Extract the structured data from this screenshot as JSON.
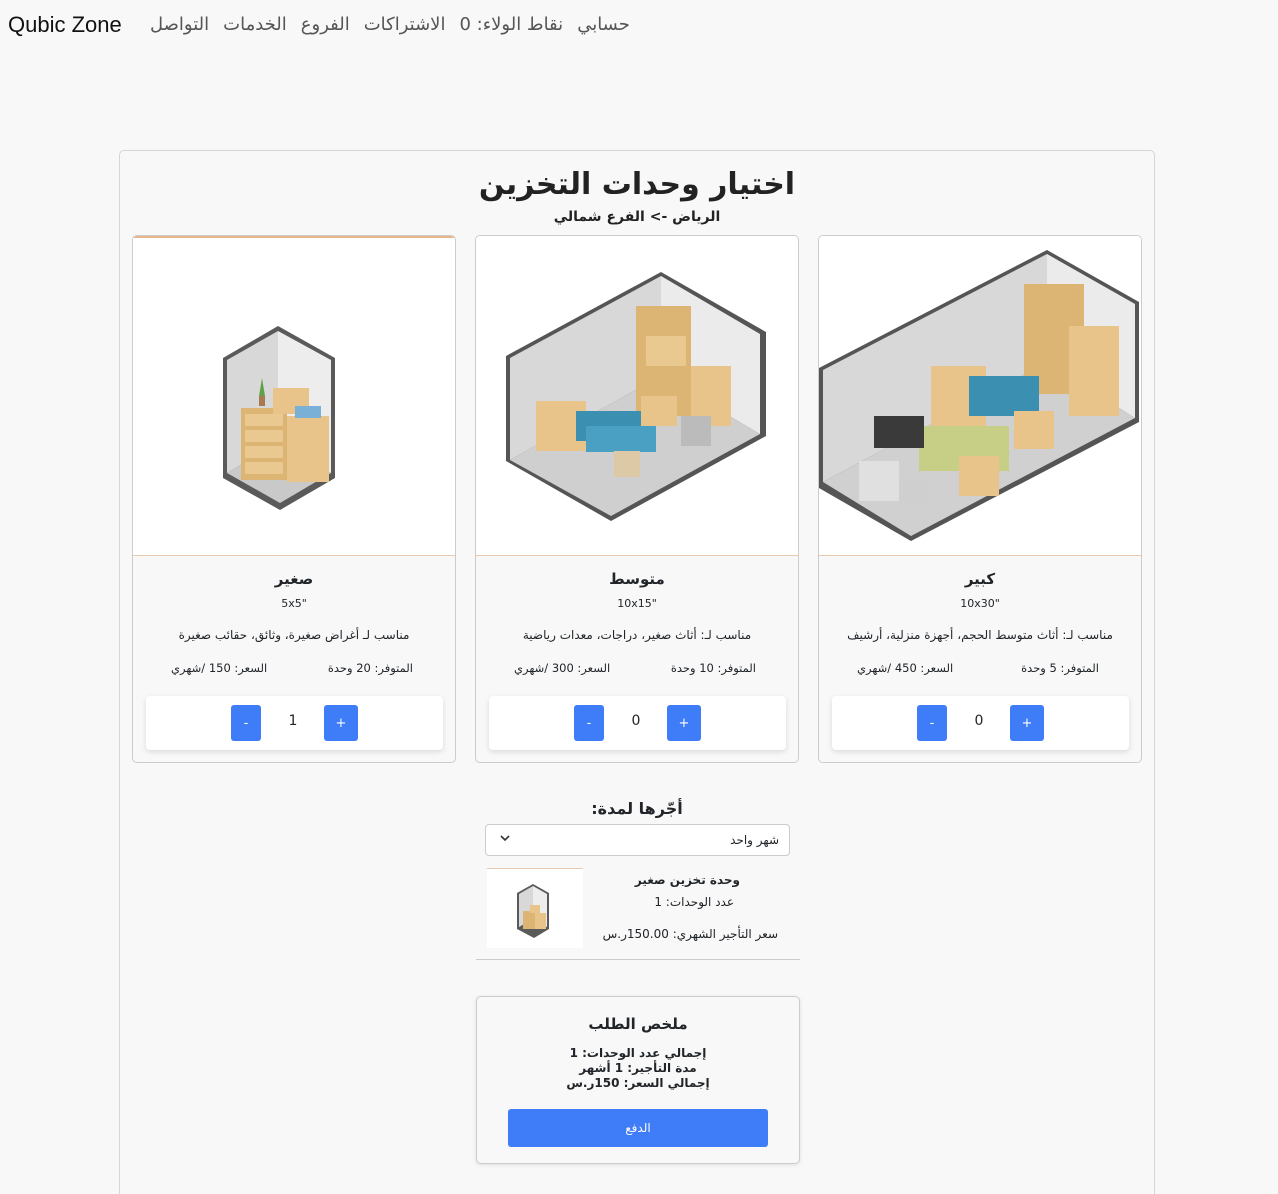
{
  "nav": {
    "brand": "Qubic Zone",
    "items": [
      "حسابي",
      "نقاط الولاء: 0",
      "الاشتراكات",
      "الفروع",
      "الخدمات",
      "التواصل"
    ]
  },
  "page": {
    "title": "اختيار وحدات التخزين",
    "subtitle": "الرياض -> الفرع شمالي"
  },
  "units": [
    {
      "name": "صغير",
      "size": "5x5\"",
      "description": "مناسب لـ أغراض صغيرة، وثائق، حقائب صغيرة",
      "available": "المتوفر: 20 وحدة",
      "price": "السعر: 150 /شهري",
      "quantity": "1",
      "minus": "-",
      "plus": "+"
    },
    {
      "name": "متوسط",
      "size": "10x15\"",
      "description": "مناسب لـ: أثاث صغير، دراجات، معدات رياضية",
      "available": "المتوفر: 10 وحدة",
      "price": "السعر: 300 /شهري",
      "quantity": "0",
      "minus": "-",
      "plus": "+"
    },
    {
      "name": "كبير",
      "size": "10x30\"",
      "description": "مناسب لـ: أثاث متوسط الحجم، أجهزة منزلية، أرشيف",
      "available": "المتوفر: 5 وحدة",
      "price": "السعر: 450 /شهري",
      "quantity": "0",
      "minus": "-",
      "plus": "+"
    }
  ],
  "rental": {
    "label": "أجّرها لمدة:",
    "selected": "شهر واحد"
  },
  "selected_item": {
    "name": "وحدة تخزين صغير",
    "count": "عدد الوحدات: 1",
    "price": "سعر التأجير الشهري: 150.00ر.س"
  },
  "summary": {
    "title": "ملخص الطلب",
    "total_units": "إجمالي عدد الوحدات: 1",
    "duration": "مدة التأجير: 1 أشهر",
    "total_price": "إجمالي السعر: 150ر.س",
    "pay_label": "الدفع"
  },
  "colors": {
    "accent": "#3f7cf7",
    "box": "#e8c48a",
    "sofa": "#3b8fb0"
  }
}
